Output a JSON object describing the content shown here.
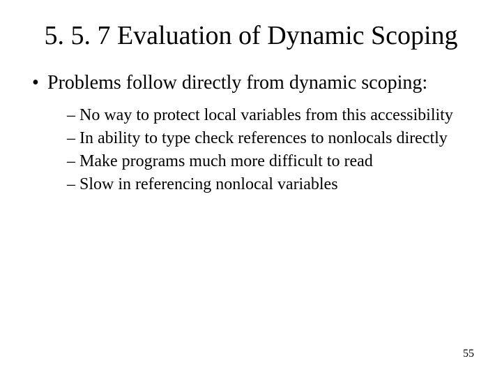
{
  "title": "5. 5. 7 Evaluation of Dynamic Scoping",
  "main_bullet": "Problems follow directly from dynamic scoping:",
  "sub_items": [
    "No way to protect local variables from this accessibility",
    "In ability to type check references to nonlocals directly",
    "Make programs much more difficult to read",
    "Slow in referencing nonlocal variables"
  ],
  "page_number": "55"
}
